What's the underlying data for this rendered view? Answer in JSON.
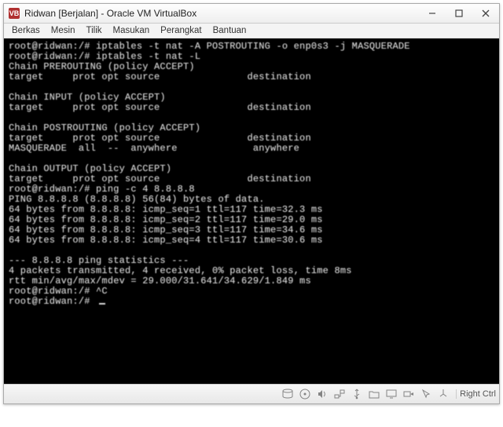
{
  "window": {
    "title": "Ridwan  [Berjalan] - Oracle VM VirtualBox",
    "icon_label": "VB"
  },
  "menu": {
    "items": [
      "Berkas",
      "Mesin",
      "Tilik",
      "Masukan",
      "Perangkat",
      "Bantuan"
    ]
  },
  "terminal": {
    "lines": [
      "root@ridwan:/# iptables -t nat -A POSTROUTING -o enp0s3 -j MASQUERADE",
      "root@ridwan:/# iptables -t nat -L",
      "Chain PREROUTING (policy ACCEPT)",
      "target     prot opt source               destination",
      "",
      "Chain INPUT (policy ACCEPT)",
      "target     prot opt source               destination",
      "",
      "Chain POSTROUTING (policy ACCEPT)",
      "target     prot opt source               destination",
      "MASQUERADE  all  --  anywhere             anywhere",
      "",
      "Chain OUTPUT (policy ACCEPT)",
      "target     prot opt source               destination",
      "root@ridwan:/# ping -c 4 8.8.8.8",
      "PING 8.8.8.8 (8.8.8.8) 56(84) bytes of data.",
      "64 bytes from 8.8.8.8: icmp_seq=1 ttl=117 time=32.3 ms",
      "64 bytes from 8.8.8.8: icmp_seq=2 ttl=117 time=29.0 ms",
      "64 bytes from 8.8.8.8: icmp_seq=3 ttl=117 time=34.6 ms",
      "64 bytes from 8.8.8.8: icmp_seq=4 ttl=117 time=30.6 ms",
      "",
      "--- 8.8.8.8 ping statistics ---",
      "4 packets transmitted, 4 received, 0% packet loss, time 8ms",
      "rtt min/avg/max/mdev = 29.000/31.641/34.629/1.849 ms",
      "root@ridwan:/# ^C",
      "root@ridwan:/# "
    ]
  },
  "statusbar": {
    "text": "Right Ctrl"
  }
}
